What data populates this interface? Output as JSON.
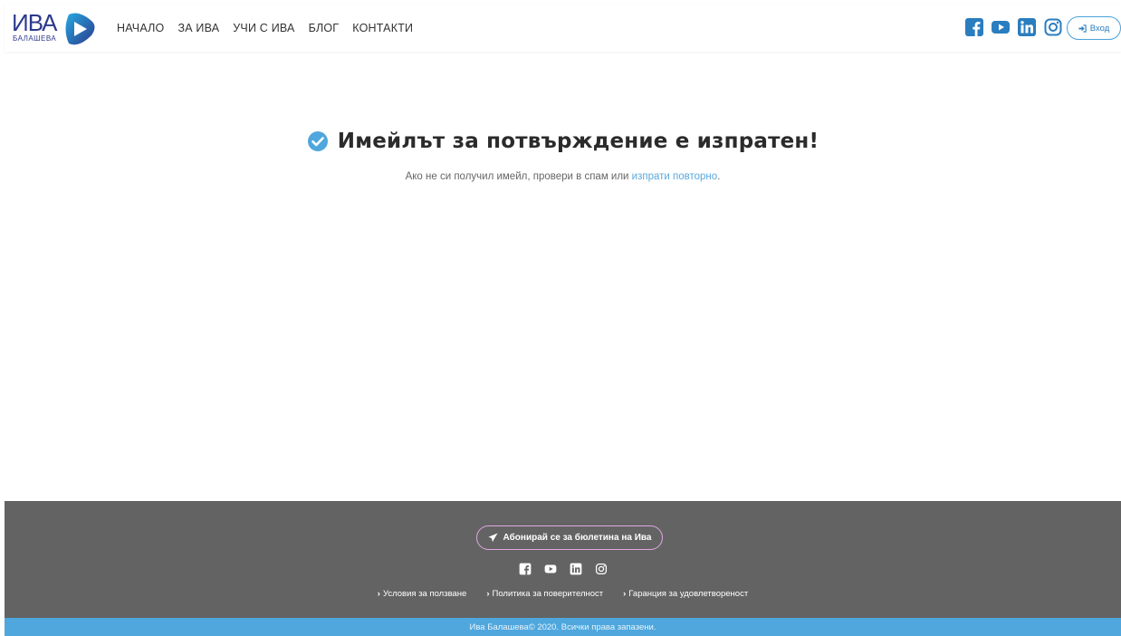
{
  "header": {
    "logo": {
      "main": "ИВА",
      "sub": "БАЛАШЕВА"
    },
    "nav": [
      {
        "label": "НАЧАЛО"
      },
      {
        "label": "ЗА ИВА"
      },
      {
        "label": "УЧИ С ИВА"
      },
      {
        "label": "БЛОГ"
      },
      {
        "label": "КОНТАКТИ"
      }
    ],
    "socials": [
      "facebook-icon",
      "youtube-icon",
      "linkedin-icon",
      "instagram-icon"
    ],
    "login_label": "Вход"
  },
  "main": {
    "title": "Имейлът за потвърждение е изпратен!",
    "subtitle_before": "Ако не си получил имейл, провери в спам или ",
    "subtitle_link": "изпрати повторно",
    "subtitle_after": "."
  },
  "footer": {
    "subscribe_label": "Абонирай се за бюлетина на Ива",
    "links": [
      {
        "label": "Условия за ползване"
      },
      {
        "label": "Политика за поверителност"
      },
      {
        "label": "Гаранция за удовлетвореност"
      }
    ],
    "copyright": "Ива Балашева© 2020. Всички права запазени."
  },
  "colors": {
    "brand_blue": "#2b3a8c",
    "accent": "#4fa7dd",
    "footer_bg": "#636363",
    "subscribe_border": "#e0a8e4"
  }
}
